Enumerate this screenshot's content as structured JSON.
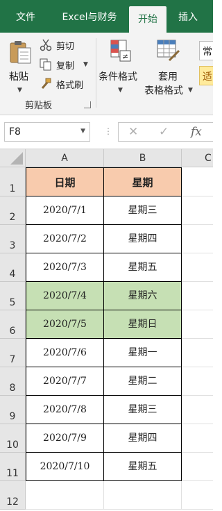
{
  "tabs": [
    "文件",
    "Excel与财务",
    "开始",
    "插入"
  ],
  "active_tab": "开始",
  "ribbon": {
    "paste_label": "粘贴",
    "cut_label": "剪切",
    "copy_label": "复制",
    "format_painter_label": "格式刷",
    "clipboard_group_label": "剪贴板",
    "conditional_format_label": "条件格式",
    "table_format_label_1": "套用",
    "table_format_label_2": "表格格式",
    "style_partial_1": "常",
    "style_partial_2": "适"
  },
  "formula_bar": {
    "name_box": "F8",
    "cancel_icon": "✕",
    "enter_icon": "✓",
    "fx_label": "fx",
    "formula": ""
  },
  "sheet": {
    "columns": [
      "A",
      "B",
      "C"
    ],
    "row_numbers": [
      "1",
      "2",
      "3",
      "4",
      "5",
      "6",
      "7",
      "8",
      "9",
      "10",
      "11",
      "12"
    ],
    "header": [
      "日期",
      "星期"
    ],
    "rows": [
      [
        "2020/7/1",
        "星期三"
      ],
      [
        "2020/7/2",
        "星期四"
      ],
      [
        "2020/7/3",
        "星期五"
      ],
      [
        "2020/7/4",
        "星期六"
      ],
      [
        "2020/7/5",
        "星期日"
      ],
      [
        "2020/7/6",
        "星期一"
      ],
      [
        "2020/7/7",
        "星期二"
      ],
      [
        "2020/7/8",
        "星期三"
      ],
      [
        "2020/7/9",
        "星期四"
      ],
      [
        "2020/7/10",
        "星期五"
      ]
    ],
    "highlighted_rows": [
      3,
      4
    ]
  },
  "colors": {
    "excel_green": "#217346",
    "header_fill": "#f8cbad",
    "weekend_fill": "#c6e0b4"
  }
}
